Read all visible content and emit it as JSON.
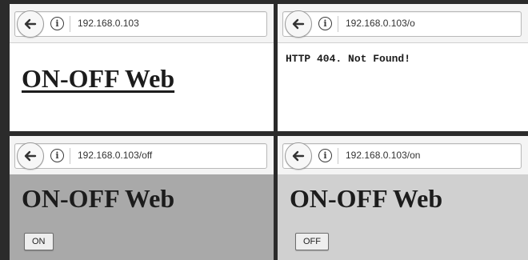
{
  "panels": [
    {
      "url": "192.168.0.103",
      "heading": "ON-OFF Web"
    },
    {
      "url": "192.168.0.103/o",
      "error": "HTTP 404. Not Found!"
    },
    {
      "url": "192.168.0.103/off",
      "heading": "ON-OFF Web",
      "button": "ON"
    },
    {
      "url": "192.168.0.103/on",
      "heading": "ON-OFF Web",
      "button": "OFF"
    }
  ],
  "icons": {
    "back": "back-arrow-icon",
    "info": "info-icon"
  },
  "colors": {
    "page_white": "#ffffff",
    "page_grey_dark": "#a9a9a9",
    "page_grey_light": "#d0d0d0",
    "divider": "#2b2b2b"
  }
}
